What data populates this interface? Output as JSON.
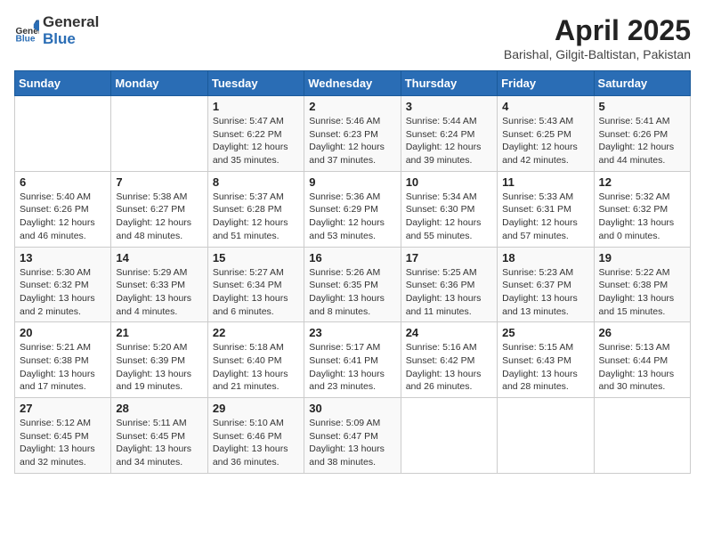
{
  "logo": {
    "general": "General",
    "blue": "Blue"
  },
  "title": "April 2025",
  "subtitle": "Barishal, Gilgit-Baltistan, Pakistan",
  "weekdays": [
    "Sunday",
    "Monday",
    "Tuesday",
    "Wednesday",
    "Thursday",
    "Friday",
    "Saturday"
  ],
  "weeks": [
    [
      {
        "day": "",
        "info": ""
      },
      {
        "day": "",
        "info": ""
      },
      {
        "day": "1",
        "info": "Sunrise: 5:47 AM\nSunset: 6:22 PM\nDaylight: 12 hours and 35 minutes."
      },
      {
        "day": "2",
        "info": "Sunrise: 5:46 AM\nSunset: 6:23 PM\nDaylight: 12 hours and 37 minutes."
      },
      {
        "day": "3",
        "info": "Sunrise: 5:44 AM\nSunset: 6:24 PM\nDaylight: 12 hours and 39 minutes."
      },
      {
        "day": "4",
        "info": "Sunrise: 5:43 AM\nSunset: 6:25 PM\nDaylight: 12 hours and 42 minutes."
      },
      {
        "day": "5",
        "info": "Sunrise: 5:41 AM\nSunset: 6:26 PM\nDaylight: 12 hours and 44 minutes."
      }
    ],
    [
      {
        "day": "6",
        "info": "Sunrise: 5:40 AM\nSunset: 6:26 PM\nDaylight: 12 hours and 46 minutes."
      },
      {
        "day": "7",
        "info": "Sunrise: 5:38 AM\nSunset: 6:27 PM\nDaylight: 12 hours and 48 minutes."
      },
      {
        "day": "8",
        "info": "Sunrise: 5:37 AM\nSunset: 6:28 PM\nDaylight: 12 hours and 51 minutes."
      },
      {
        "day": "9",
        "info": "Sunrise: 5:36 AM\nSunset: 6:29 PM\nDaylight: 12 hours and 53 minutes."
      },
      {
        "day": "10",
        "info": "Sunrise: 5:34 AM\nSunset: 6:30 PM\nDaylight: 12 hours and 55 minutes."
      },
      {
        "day": "11",
        "info": "Sunrise: 5:33 AM\nSunset: 6:31 PM\nDaylight: 12 hours and 57 minutes."
      },
      {
        "day": "12",
        "info": "Sunrise: 5:32 AM\nSunset: 6:32 PM\nDaylight: 13 hours and 0 minutes."
      }
    ],
    [
      {
        "day": "13",
        "info": "Sunrise: 5:30 AM\nSunset: 6:32 PM\nDaylight: 13 hours and 2 minutes."
      },
      {
        "day": "14",
        "info": "Sunrise: 5:29 AM\nSunset: 6:33 PM\nDaylight: 13 hours and 4 minutes."
      },
      {
        "day": "15",
        "info": "Sunrise: 5:27 AM\nSunset: 6:34 PM\nDaylight: 13 hours and 6 minutes."
      },
      {
        "day": "16",
        "info": "Sunrise: 5:26 AM\nSunset: 6:35 PM\nDaylight: 13 hours and 8 minutes."
      },
      {
        "day": "17",
        "info": "Sunrise: 5:25 AM\nSunset: 6:36 PM\nDaylight: 13 hours and 11 minutes."
      },
      {
        "day": "18",
        "info": "Sunrise: 5:23 AM\nSunset: 6:37 PM\nDaylight: 13 hours and 13 minutes."
      },
      {
        "day": "19",
        "info": "Sunrise: 5:22 AM\nSunset: 6:38 PM\nDaylight: 13 hours and 15 minutes."
      }
    ],
    [
      {
        "day": "20",
        "info": "Sunrise: 5:21 AM\nSunset: 6:38 PM\nDaylight: 13 hours and 17 minutes."
      },
      {
        "day": "21",
        "info": "Sunrise: 5:20 AM\nSunset: 6:39 PM\nDaylight: 13 hours and 19 minutes."
      },
      {
        "day": "22",
        "info": "Sunrise: 5:18 AM\nSunset: 6:40 PM\nDaylight: 13 hours and 21 minutes."
      },
      {
        "day": "23",
        "info": "Sunrise: 5:17 AM\nSunset: 6:41 PM\nDaylight: 13 hours and 23 minutes."
      },
      {
        "day": "24",
        "info": "Sunrise: 5:16 AM\nSunset: 6:42 PM\nDaylight: 13 hours and 26 minutes."
      },
      {
        "day": "25",
        "info": "Sunrise: 5:15 AM\nSunset: 6:43 PM\nDaylight: 13 hours and 28 minutes."
      },
      {
        "day": "26",
        "info": "Sunrise: 5:13 AM\nSunset: 6:44 PM\nDaylight: 13 hours and 30 minutes."
      }
    ],
    [
      {
        "day": "27",
        "info": "Sunrise: 5:12 AM\nSunset: 6:45 PM\nDaylight: 13 hours and 32 minutes."
      },
      {
        "day": "28",
        "info": "Sunrise: 5:11 AM\nSunset: 6:45 PM\nDaylight: 13 hours and 34 minutes."
      },
      {
        "day": "29",
        "info": "Sunrise: 5:10 AM\nSunset: 6:46 PM\nDaylight: 13 hours and 36 minutes."
      },
      {
        "day": "30",
        "info": "Sunrise: 5:09 AM\nSunset: 6:47 PM\nDaylight: 13 hours and 38 minutes."
      },
      {
        "day": "",
        "info": ""
      },
      {
        "day": "",
        "info": ""
      },
      {
        "day": "",
        "info": ""
      }
    ]
  ]
}
